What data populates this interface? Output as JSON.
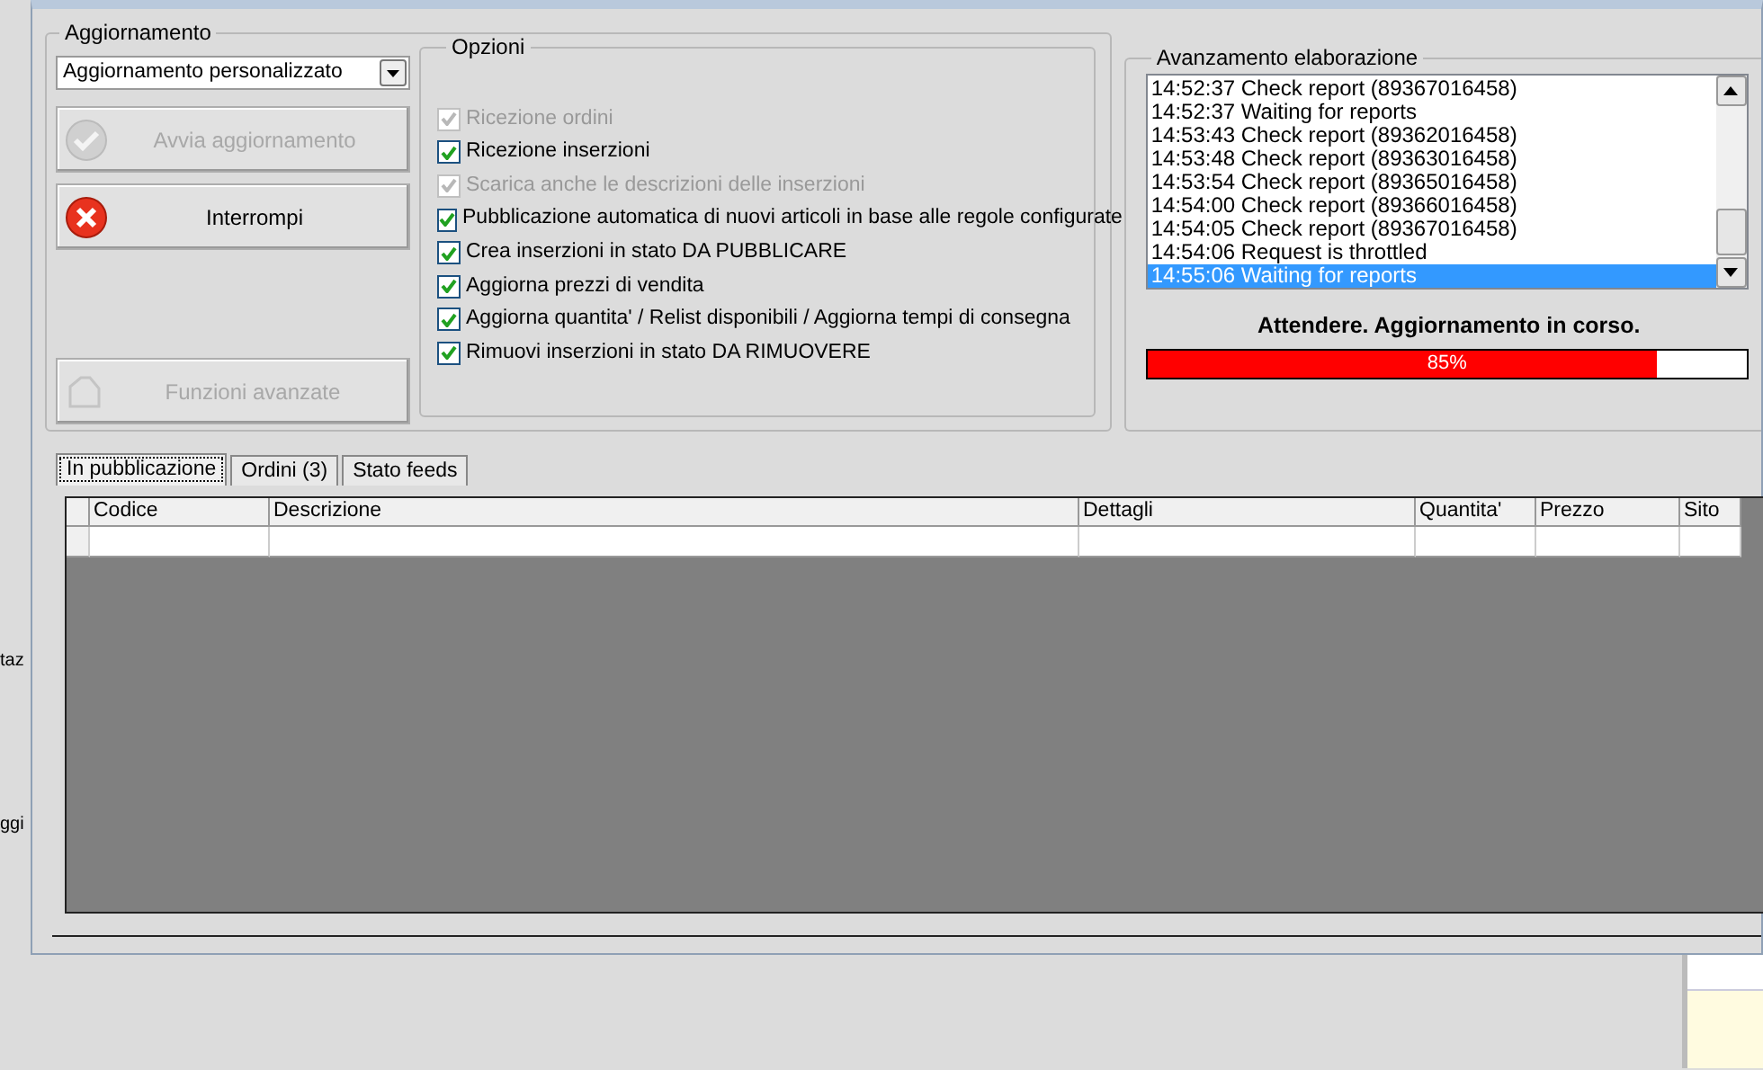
{
  "background_window": {
    "fragments": [
      "taz",
      "ggi"
    ]
  },
  "update_group": {
    "title": "Aggiornamento",
    "mode_select": {
      "value": "Aggiornamento personalizzato"
    },
    "buttons": [
      {
        "label": "Avvia aggiornamento",
        "disabled": true
      },
      {
        "label": "Interrompi",
        "disabled": false
      }
    ],
    "advanced_button": {
      "label": "Funzioni avanzate",
      "disabled": true
    }
  },
  "options": {
    "title": "Opzioni",
    "items": [
      {
        "label": "Ricezione ordini",
        "checked": true,
        "disabled": true
      },
      {
        "label": "Ricezione inserzioni",
        "checked": true,
        "disabled": false
      },
      {
        "label": "Scarica anche le descrizioni delle inserzioni",
        "checked": true,
        "disabled": true
      },
      {
        "label": "Pubblicazione automatica di nuovi articoli in base alle regole configurate",
        "checked": true,
        "disabled": false
      },
      {
        "label": "Crea inserzioni in stato DA PUBBLICARE",
        "checked": true,
        "disabled": false
      },
      {
        "label": "Aggiorna prezzi di vendita",
        "checked": true,
        "disabled": false
      },
      {
        "label": "Aggiorna quantita' / Relist disponibili / Aggiorna tempi di consegna",
        "checked": true,
        "disabled": false
      },
      {
        "label": "Rimuovi inserzioni in stato DA RIMUOVERE",
        "checked": true,
        "disabled": false
      }
    ]
  },
  "progress": {
    "title": "Avanzamento elaborazione",
    "log": [
      {
        "text": "14:52:37 Check report (89367016458)",
        "selected": false
      },
      {
        "text": "14:52:37 Waiting for reports",
        "selected": false
      },
      {
        "text": "14:53:43 Check report (89362016458)",
        "selected": false
      },
      {
        "text": "14:53:48 Check report (89363016458)",
        "selected": false
      },
      {
        "text": "14:53:54 Check report (89365016458)",
        "selected": false
      },
      {
        "text": "14:54:00 Check report (89366016458)",
        "selected": false
      },
      {
        "text": "14:54:05 Check report (89367016458)",
        "selected": false
      },
      {
        "text": "14:54:06 Request is throttled",
        "selected": false
      },
      {
        "text": "14:55:06 Waiting for reports",
        "selected": true
      }
    ],
    "status": "Attendere. Aggiornamento in corso.",
    "bar": {
      "level": 0.85,
      "reading": "85%"
    }
  },
  "tabs": [
    {
      "label": "In pubblicazione",
      "selected": true
    },
    {
      "label": "Ordini (3)",
      "selected": false
    },
    {
      "label": "Stato feeds",
      "selected": false
    }
  ],
  "table": {
    "columns": [
      "Codice",
      "Descrizione",
      "Dettagli",
      "Quantita'",
      "Prezzo",
      "Sito"
    ]
  }
}
